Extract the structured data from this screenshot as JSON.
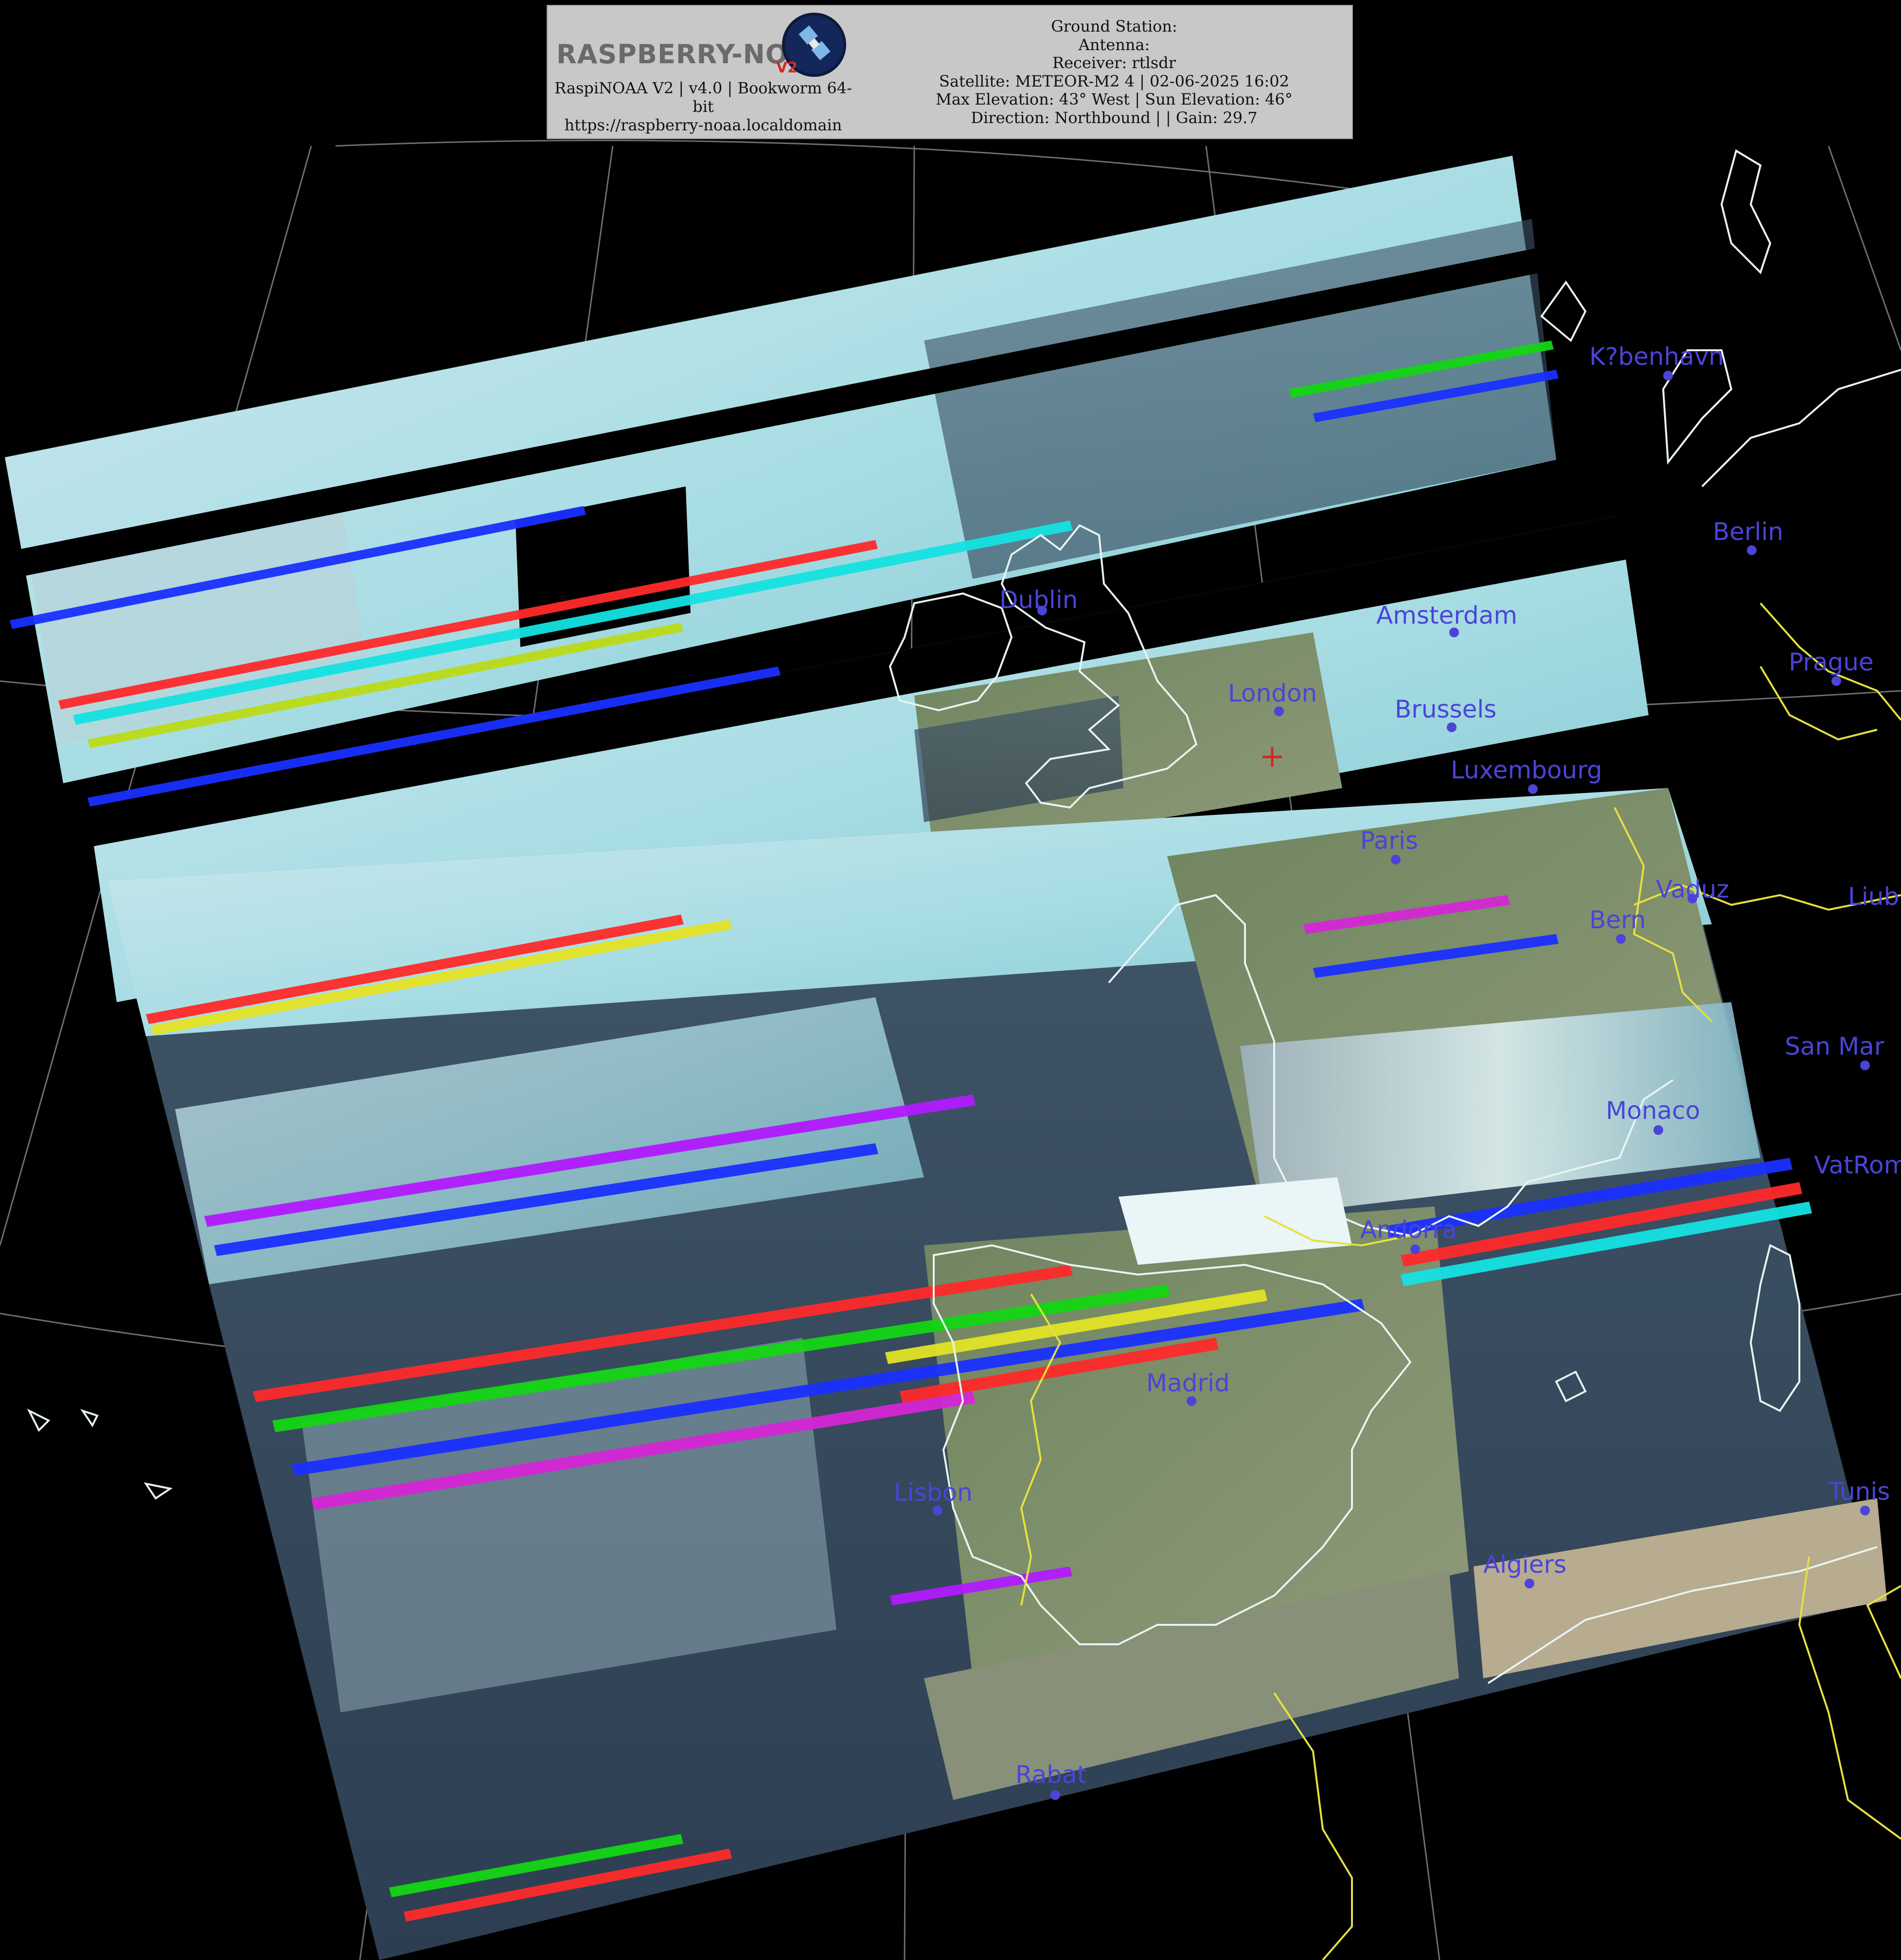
{
  "header": {
    "logo_text": "RASPBERRY-NOAA",
    "logo_version": "V2",
    "app_line": "RaspiNOAA V2 | v4.0 | Bookworm 64-bit",
    "url": "https://raspberry-noaa.localdomain",
    "ground_station": "Ground Station:",
    "antenna": "Antenna:",
    "receiver": "Receiver: rtlsdr",
    "satellite": "Satellite: METEOR-M2 4 | 02-06-2025 16:02",
    "elevation": "Max Elevation: 43° West | Sun Elevation: 46°",
    "direction": "Direction: Northbound | | Gain: 29.7"
  },
  "cities": [
    {
      "name": "K?benhavn"
    },
    {
      "name": "Berlin"
    },
    {
      "name": "Dublin"
    },
    {
      "name": "Amsterdam"
    },
    {
      "name": "Prague"
    },
    {
      "name": "London"
    },
    {
      "name": "Brussels"
    },
    {
      "name": "Luxembourg"
    },
    {
      "name": "Paris"
    },
    {
      "name": "Vaduz"
    },
    {
      "name": "Liub"
    },
    {
      "name": "Bern"
    },
    {
      "name": "San Mar"
    },
    {
      "name": "Monaco"
    },
    {
      "name": "VatRom"
    },
    {
      "name": "Andorra"
    },
    {
      "name": "Madrid"
    },
    {
      "name": "Lisbon"
    },
    {
      "name": "Tunis"
    },
    {
      "name": "Algiers"
    },
    {
      "name": "Rabat"
    }
  ],
  "colors": {
    "city_label": "#4b44d8",
    "coastline": "#e8f4f0",
    "border": "#e6e040",
    "graticule": "#8a8a8a"
  }
}
